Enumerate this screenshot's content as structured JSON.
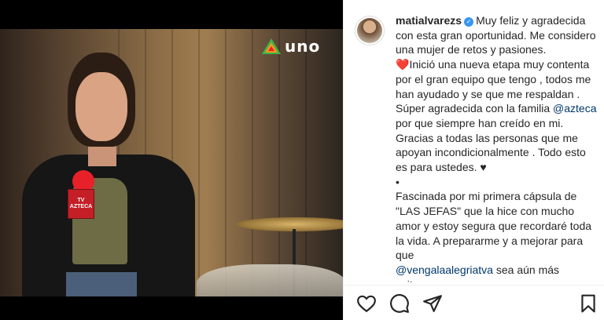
{
  "media": {
    "channel_logo_text": "uno",
    "mic_flag_text": "TV AZTECA"
  },
  "post": {
    "username": "matialvarezs",
    "verified": true,
    "caption": {
      "p1": "Muy feliz y agradecida con esta gran oportunidad. Me considero una mujer de retos y pasiones.",
      "heart": "❤️",
      "p2": "Inició una nueva etapa muy contenta por el gran equipo que tengo , todos me han ayudado y se que me respaldan .",
      "p3_pre": "Súper agradecida con la familia",
      "p3_mention": "@azteca",
      "p3_post": "por que siempre han creído en mi.",
      "p4": "Gracias a todas las personas que me apoyan incondicionalmente . Todo esto es para ustedes. ♥",
      "dot1": "•",
      "p5": "Fascinada por mi primera cápsula de \"LAS JEFAS\" que la hice con mucho amor y estoy segura que recordaré toda la vida. A prepararme y a mejorar para que",
      "p5_mention": "@vengalaalegriatva",
      "p5_post": "sea aún más exitoso",
      "dot2": ".",
      "dot3": "."
    }
  },
  "actions": {
    "like_icon": "heart-icon",
    "comment_icon": "comment-icon",
    "share_icon": "share-icon",
    "save_icon": "bookmark-icon"
  },
  "colors": {
    "link": "#00376b",
    "verified": "#3897f0",
    "text": "#262626"
  }
}
